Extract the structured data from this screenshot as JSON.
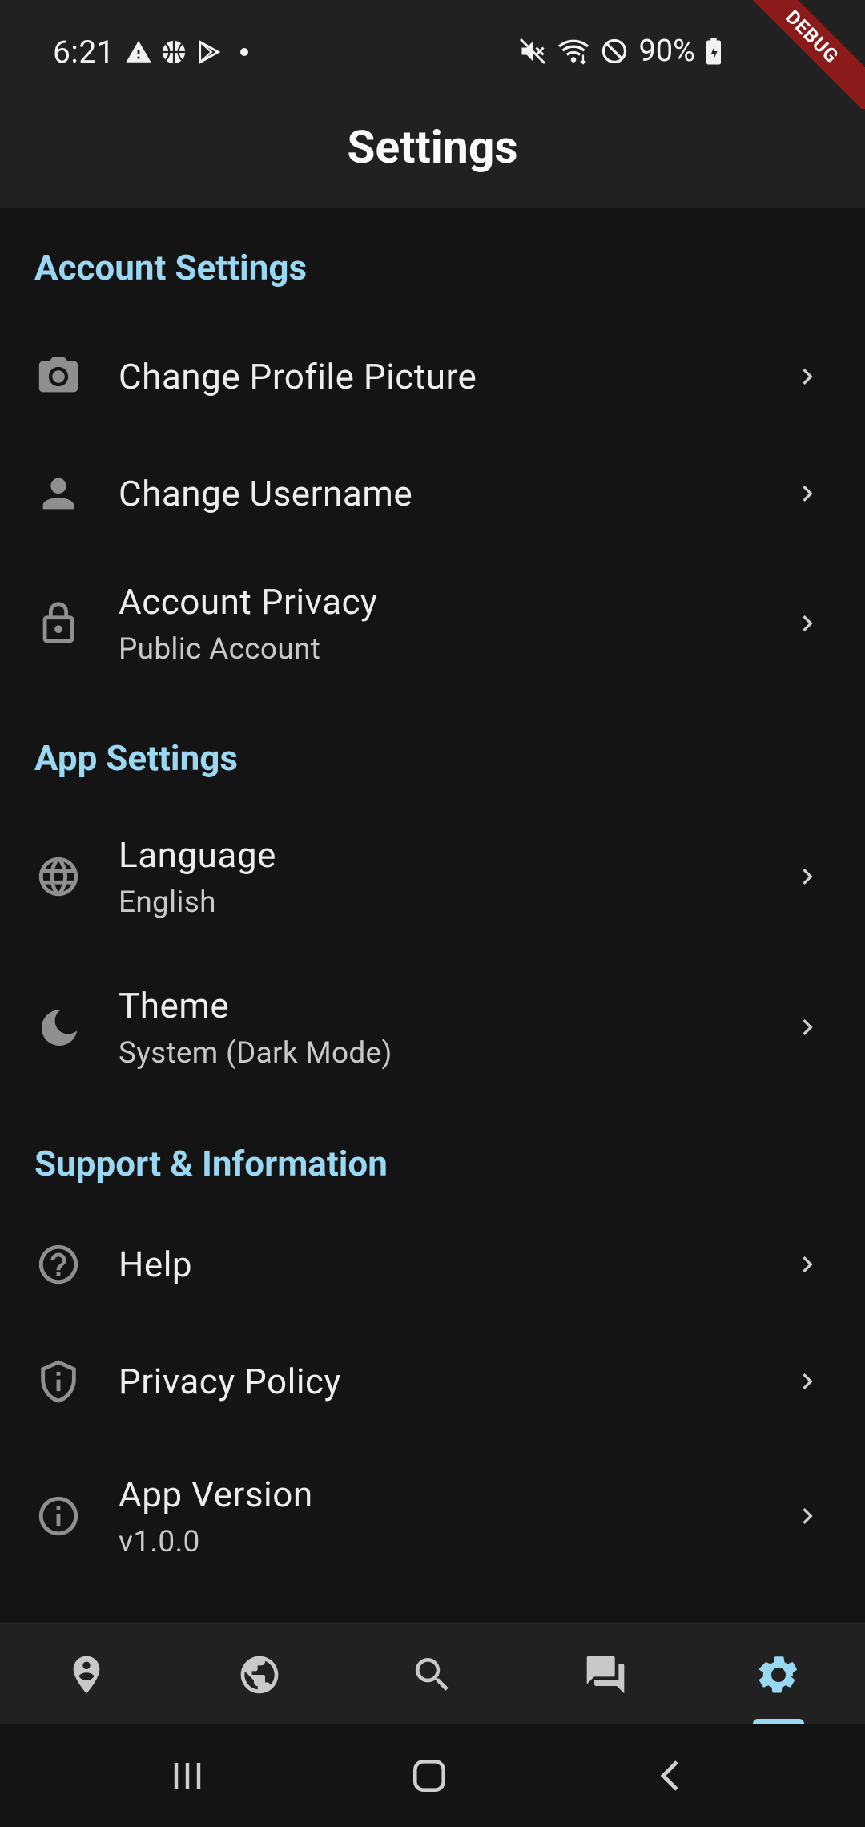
{
  "status_bar": {
    "time": "6:21",
    "battery_percent": "90%",
    "left_icons": [
      "warning-icon",
      "basketball-icon",
      "play-store-icon",
      "dot-icon"
    ],
    "right_icons": [
      "mute-icon",
      "wifi-icon",
      "do-not-disturb-icon",
      "battery-charging-icon"
    ]
  },
  "debug_banner": "DEBUG",
  "app_bar": {
    "title": "Settings"
  },
  "sections": [
    {
      "title": "Account Settings",
      "items": [
        {
          "icon": "camera-icon",
          "title": "Change Profile Picture",
          "subtitle": ""
        },
        {
          "icon": "person-icon",
          "title": "Change Username",
          "subtitle": ""
        },
        {
          "icon": "lock-icon",
          "title": "Account Privacy",
          "subtitle": "Public Account"
        }
      ]
    },
    {
      "title": "App Settings",
      "items": [
        {
          "icon": "globe-icon",
          "title": "Language",
          "subtitle": "English"
        },
        {
          "icon": "moon-icon",
          "title": "Theme",
          "subtitle": "System (Dark Mode)"
        }
      ]
    },
    {
      "title": "Support & Information",
      "items": [
        {
          "icon": "help-icon",
          "title": "Help",
          "subtitle": ""
        },
        {
          "icon": "shield-icon",
          "title": "Privacy Policy",
          "subtitle": ""
        },
        {
          "icon": "info-icon",
          "title": "App Version",
          "subtitle": "v1.0.0"
        }
      ]
    }
  ],
  "bottom_nav": {
    "items": [
      "map-pin-icon",
      "earth-icon",
      "search-icon",
      "chat-icon",
      "settings-gear-icon"
    ],
    "selected": "settings-gear-icon"
  },
  "colors": {
    "accent": "#9ad7f2",
    "background": "#141414",
    "bar_background": "#212121",
    "debug_red": "#8b1b1b"
  },
  "system_nav": [
    "recents-icon",
    "home-icon",
    "back-icon"
  ]
}
